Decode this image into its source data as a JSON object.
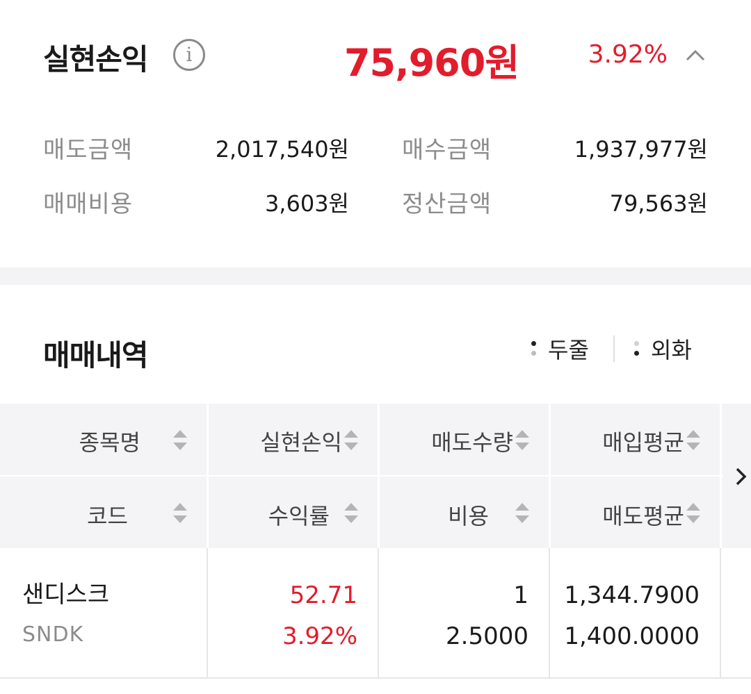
{
  "summary": {
    "title": "실현손익",
    "amount": "75,960원",
    "rate": "3.92%",
    "colors": {
      "profit": "#e21c2c"
    },
    "items": [
      {
        "label": "매도금액",
        "value": "2,017,540원"
      },
      {
        "label": "매수금액",
        "value": "1,937,977원"
      },
      {
        "label": "매매비용",
        "value": "3,603원"
      },
      {
        "label": "정산금액",
        "value": "79,563원"
      }
    ]
  },
  "history": {
    "title": "매매내역",
    "options": [
      "두줄",
      "외화"
    ],
    "headers": {
      "row1": [
        "종목명",
        "실현손익",
        "매도수량",
        "매입평균"
      ],
      "row2": [
        "코드",
        "수익률",
        "비용",
        "매도평균"
      ]
    },
    "rows": [
      {
        "name": "샌디스크",
        "code": "SNDK",
        "realized": "52.71",
        "rate": "3.92%",
        "quantity": "1",
        "cost": "2.5000",
        "buy_avg": "1,344.7900",
        "sell_avg": "1,400.0000"
      }
    ]
  },
  "icons": {
    "info": "info-icon",
    "collapse": "chevron-up-icon",
    "scroll": "chevron-right-icon",
    "sort": "sort-icon"
  }
}
